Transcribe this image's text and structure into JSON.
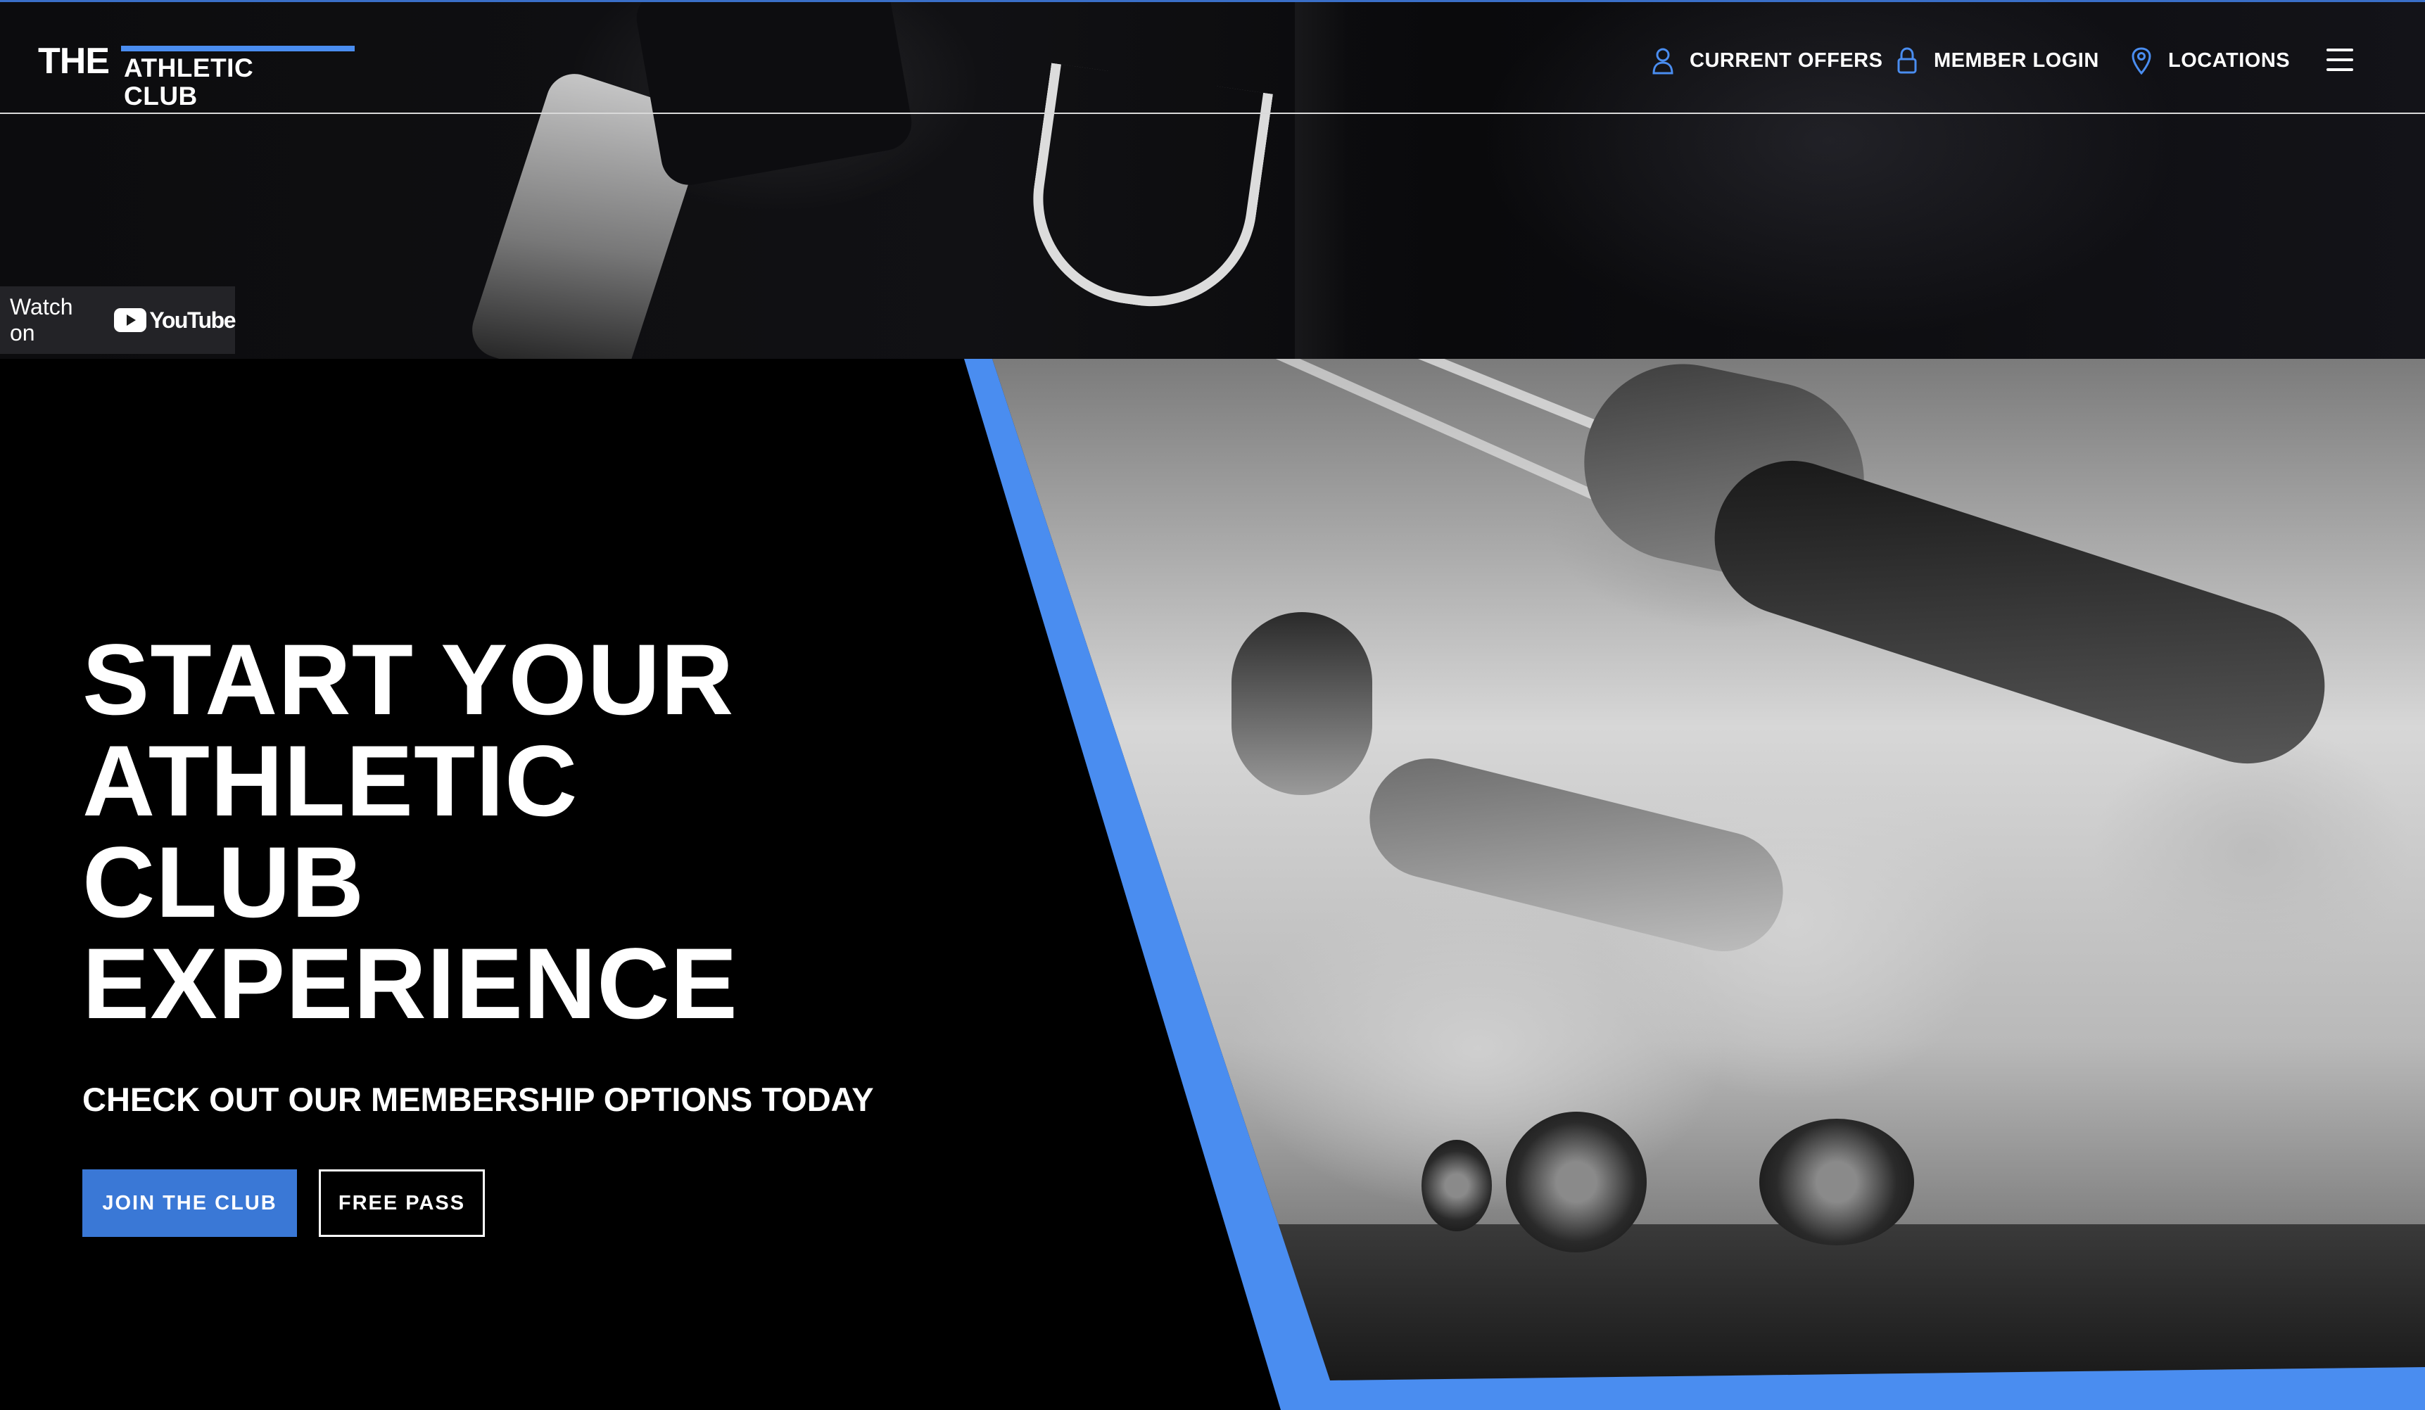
{
  "header": {
    "logo": {
      "the": "THE",
      "rest": "ATHLETIC CLUB"
    },
    "nav": [
      {
        "label": "CURRENT OFFERS",
        "icon": "user-icon"
      },
      {
        "label": "MEMBER LOGIN",
        "icon": "lock-icon"
      },
      {
        "label": "LOCATIONS",
        "icon": "location-pin-icon"
      }
    ],
    "menu_icon": "hamburger-menu-icon"
  },
  "video": {
    "watch_label": "Watch on",
    "youtube_label": "YouTube"
  },
  "hero": {
    "headline": [
      "START YOUR",
      "ATHLETIC",
      "CLUB",
      "EXPERIENCE"
    ],
    "subheadline": "CHECK OUT OUR MEMBERSHIP OPTIONS TODAY",
    "buttons": {
      "primary": "JOIN THE CLUB",
      "secondary": "FREE PASS"
    }
  },
  "colors": {
    "accent": "#4a8df0",
    "button_primary": "#3a78d6",
    "background": "#000000",
    "text": "#ffffff"
  }
}
